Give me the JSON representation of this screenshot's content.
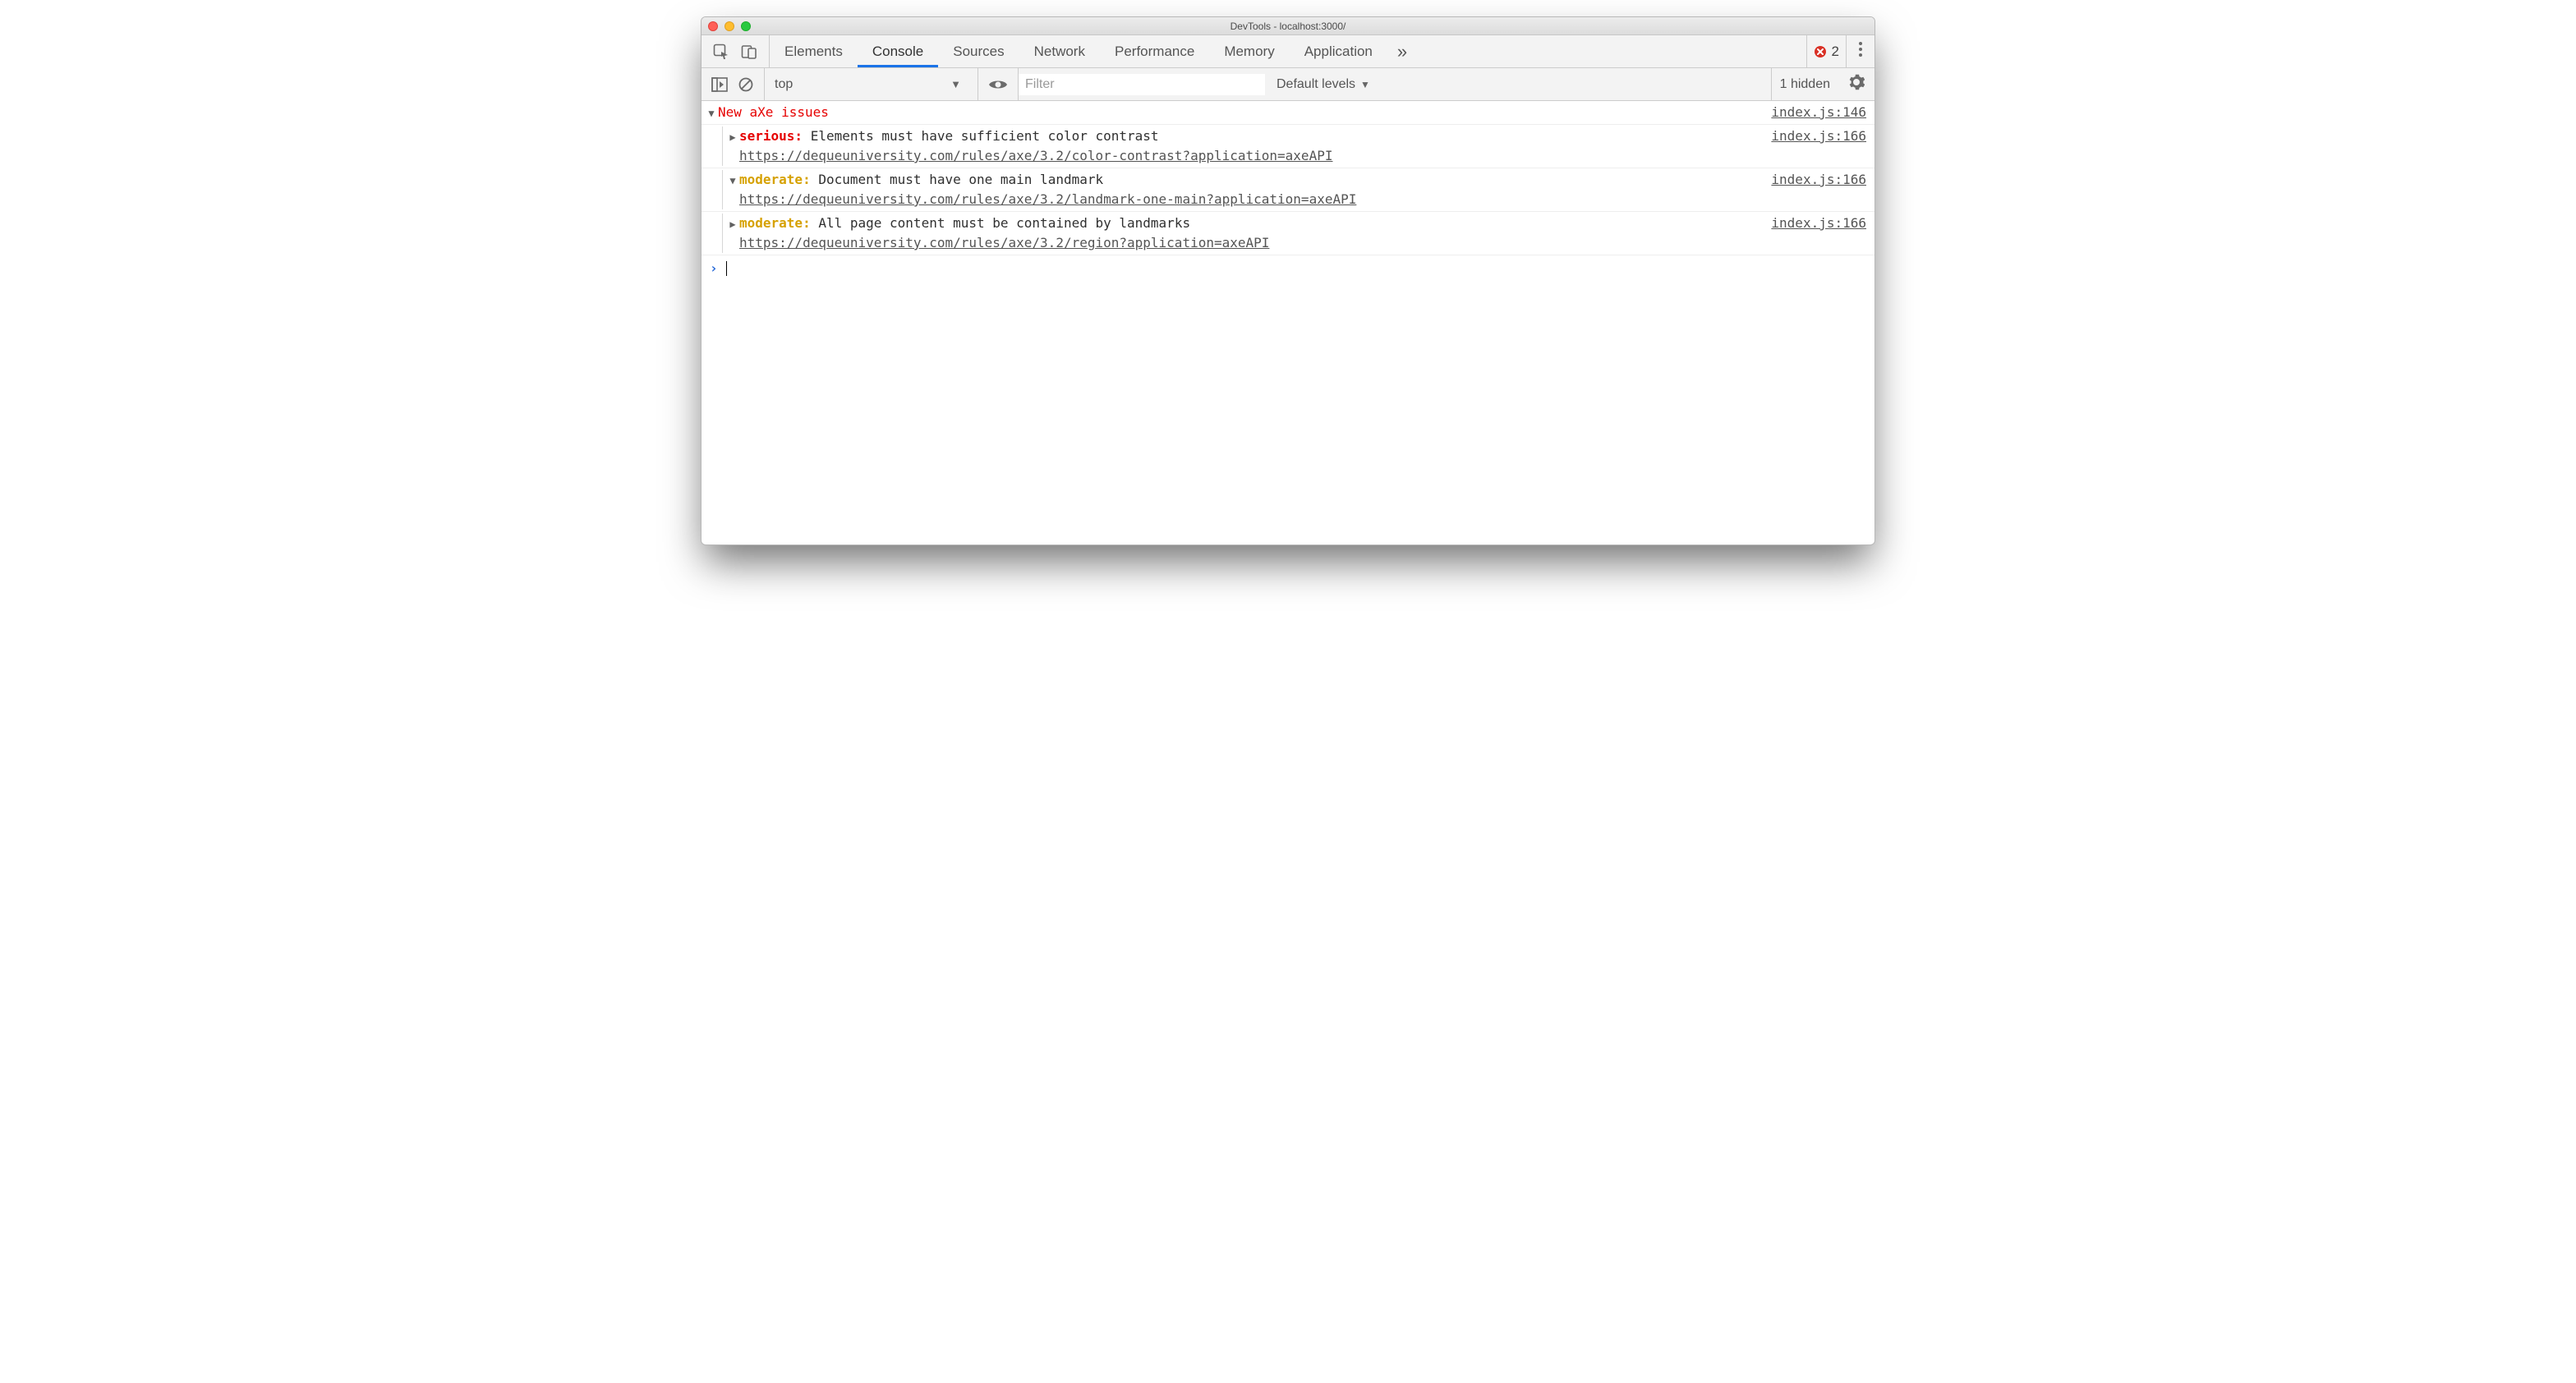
{
  "window": {
    "title": "DevTools - localhost:3000/"
  },
  "tabs": {
    "items": [
      "Elements",
      "Console",
      "Sources",
      "Network",
      "Performance",
      "Memory",
      "Application"
    ],
    "active": "Console",
    "more_icon": "»",
    "error_count": "2"
  },
  "toolbar": {
    "context": "top",
    "filter_placeholder": "Filter",
    "levels_label": "Default levels",
    "hidden_label": "1 hidden"
  },
  "console": {
    "group_title": "New aXe issues",
    "group_src": "index.js:146",
    "entries": [
      {
        "expanded": false,
        "severity": "serious:",
        "severity_class": "serious",
        "message": " Elements must have sufficient color contrast",
        "url": "https://dequeuniversity.com/rules/axe/3.2/color-contrast?application=axeAPI",
        "src": "index.js:166"
      },
      {
        "expanded": true,
        "severity": "moderate:",
        "severity_class": "moderate",
        "message": " Document must have one main landmark",
        "url": "https://dequeuniversity.com/rules/axe/3.2/landmark-one-main?application=axeAPI",
        "src": "index.js:166"
      },
      {
        "expanded": false,
        "severity": "moderate:",
        "severity_class": "moderate",
        "message": " All page content must be contained by landmarks",
        "url": "https://dequeuniversity.com/rules/axe/3.2/region?application=axeAPI",
        "src": "index.js:166"
      }
    ]
  }
}
